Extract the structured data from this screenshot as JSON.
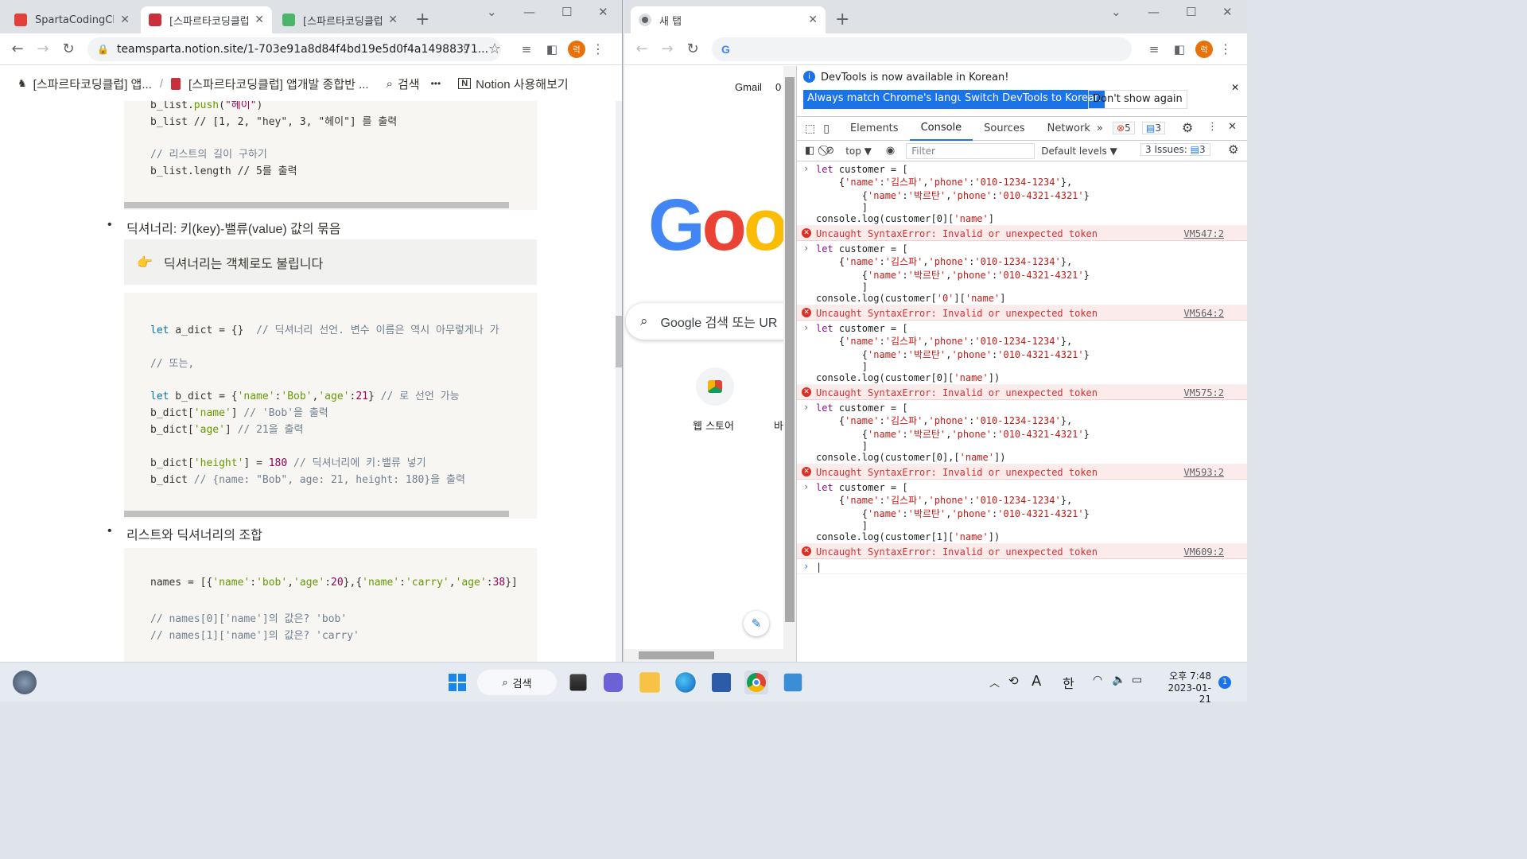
{
  "left_window": {
    "tabs": [
      {
        "title": "SpartaCodingClub",
        "color": "#e2403a"
      },
      {
        "title": "[스파르타코딩클럽",
        "color": "#c9303a"
      },
      {
        "title": "[스파르타코딩클럽",
        "color": "#4bb56a"
      }
    ],
    "new_tab": "+",
    "url": "teamsparta.notion.site/1-703e91a8d84f4bd19e5d0f4a14988371...",
    "avatar": "럭",
    "notion_bar": {
      "crumb1": "[스파르타코딩클럽] 앱...",
      "sep": "/",
      "crumb2": "[스파르타코딩클럽] 앱개발 종합반 ...",
      "search": "검색",
      "more": "•••",
      "notion": "Notion 사용해보기"
    },
    "code1": [
      "b_list.push(\"헤이\")",
      "b_list // [1, 2, \"hey\", 3, \"헤이\"] 를 출력",
      "",
      "// 리스트의 길이 구하기",
      "b_list.length // 5를 출력"
    ],
    "bullet1": "딕셔너리: 키(key)-밸류(value) 값의 묶음",
    "callout_icon": "👉",
    "callout": "딕셔너리는 객체로도 불립니다",
    "code2": [
      "let a_dict = {}  // 딕셔너리 선언. 변수 이름은 역시 아무렇게나 가",
      "",
      "// 또는,",
      "",
      "let b_dict = {'name':'Bob','age':21} // 로 선언 가능",
      "b_dict['name'] // 'Bob'을 출력",
      "b_dict['age'] // 21을 출력",
      "",
      "b_dict['height'] = 180 // 딕셔너리에 키:밸류 넣기",
      "b_dict // {name: \"Bob\", age: 21, height: 180}을 출력"
    ],
    "bullet2": "리스트와 딕셔너리의 조합",
    "code3": [
      "names = [{'name':'bob','age':20},{'name':'carry','age':38}]",
      "",
      "// names[0]['name']의 값은? 'bob'",
      "// names[1]['name']의 값은? 'carry'"
    ]
  },
  "right_window": {
    "tab_title": "새 탭",
    "new_tab": "+",
    "avatar": "럭",
    "newtab": {
      "gmail": "Gmail",
      "gmail_suffix": "0",
      "logo": "Goo",
      "search_placeholder": "Google 검색 또는 UR",
      "shortcut1": "웹 스토어",
      "shortcut2": "바"
    },
    "devtools": {
      "info": "DevTools is now available in Korean!",
      "btn1": "Always match Chrome's language",
      "btn2": "Switch DevTools to Korean",
      "btn3": "Don't show again",
      "tabs": [
        "Elements",
        "Console",
        "Sources",
        "Network"
      ],
      "more_tabs": "»",
      "errors_count": "5",
      "msgs_count": "3",
      "context": "top ▼",
      "filter_placeholder": "Filter",
      "levels": "Default levels ▼",
      "issues": "3 Issues:",
      "issues_count": "3",
      "entries": [
        {
          "type": "input",
          "lines": [
            "let customer = [",
            "    {'name':'김스파','phone':'010-1234-1234'},",
            "        {'name':'박르탄','phone':'010-4321-4321'}",
            "        ]",
            "console.log(customer[0]['name']"
          ]
        },
        {
          "type": "error",
          "text": "Uncaught SyntaxError: Invalid or unexpected token",
          "source": "VM547:2"
        },
        {
          "type": "input",
          "lines": [
            "let customer = [",
            "    {'name':'김스파','phone':'010-1234-1234'},",
            "        {'name':'박르탄','phone':'010-4321-4321'}",
            "        ]",
            "console.log(customer['0']['name']"
          ]
        },
        {
          "type": "error",
          "text": "Uncaught SyntaxError: Invalid or unexpected token",
          "source": "VM564:2"
        },
        {
          "type": "input",
          "lines": [
            "let customer = [",
            "    {'name':'김스파','phone':'010-1234-1234'},",
            "        {'name':'박르탄','phone':'010-4321-4321'}",
            "        ]",
            "console.log(customer[0]['name'])"
          ]
        },
        {
          "type": "error",
          "text": "Uncaught SyntaxError: Invalid or unexpected token",
          "source": "VM575:2"
        },
        {
          "type": "input",
          "lines": [
            "let customer = [",
            "    {'name':'김스파','phone':'010-1234-1234'},",
            "        {'name':'박르탄','phone':'010-4321-4321'}",
            "        ]",
            "console.log(customer[0],['name'])"
          ]
        },
        {
          "type": "error",
          "text": "Uncaught SyntaxError: Invalid or unexpected token",
          "source": "VM593:2"
        },
        {
          "type": "input",
          "lines": [
            "let customer = [",
            "    {'name':'김스파','phone':'010-1234-1234'},",
            "        {'name':'박르탄','phone':'010-4321-4321'}",
            "        ]",
            "console.log(customer[1]['name'])"
          ]
        },
        {
          "type": "error",
          "text": "Uncaught SyntaxError: Invalid or unexpected token",
          "source": "VM609:2"
        }
      ]
    }
  },
  "taskbar": {
    "search": "검색",
    "lang_a": "A",
    "lang_han": "한",
    "time": "오후 7:48",
    "date": "2023-01-21",
    "notif": "1"
  }
}
